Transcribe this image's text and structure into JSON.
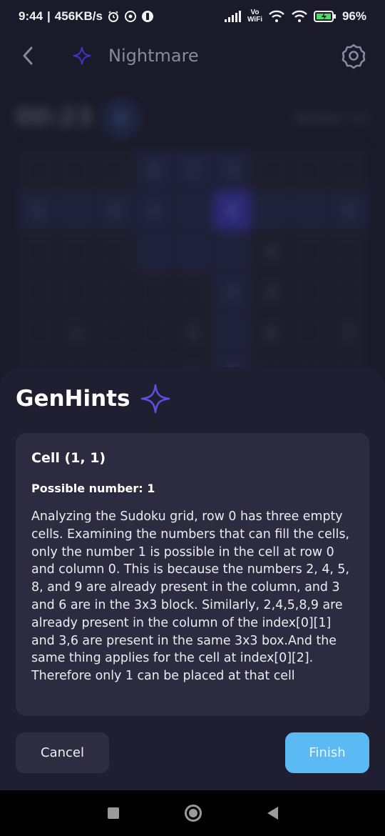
{
  "status_bar": {
    "time": "9:44",
    "net_speed": "456KB/s",
    "volte": "Vo",
    "wifi_label": "WiFi",
    "battery": "96%"
  },
  "header": {
    "title": "Nightmare"
  },
  "game": {
    "timer": "00:23",
    "mistakes": "Mistakes: 1/3",
    "pause_label": "II",
    "cells": [
      "",
      "",
      "",
      "6",
      "7",
      "3",
      "",
      "",
      "",
      "3",
      "",
      "6",
      "2",
      "",
      "1",
      "",
      "",
      "5",
      "",
      "",
      "",
      "",
      "",
      "",
      "4",
      "",
      "",
      "",
      "",
      "",
      "",
      "",
      "4",
      "3",
      "",
      "",
      "",
      "1",
      "",
      "",
      "3",
      "",
      "6",
      "",
      "7",
      "",
      "",
      "",
      "",
      "6",
      "8",
      "",
      "",
      ""
    ]
  },
  "sheet": {
    "title": "GenHints",
    "cell_label": "Cell (1, 1)",
    "possible_number": "Possible number: 1",
    "explanation": "Analyzing the Sudoku grid, row 0 has three empty cells. Examining the numbers that can fill the cells, only the number 1 is possible in the cell at row 0 and column 0. This is because the numbers 2, 4, 5, 8, and 9 are already present in the column, and 3 and 6 are in the 3x3 block. Similarly, 2,4,5,8,9 are already present in the column of the index[0][1] and 3,6 are present in the same 3x3 box.And the same thing applies for the cell at index[0][2]. Therefore only 1 can be placed at that cell",
    "cancel_label": "Cancel",
    "finish_label": "Finish"
  },
  "colors": {
    "accent": "#5b4ee0",
    "finish_button": "#5bb9f4",
    "sheet_bg": "#201f32",
    "card_bg": "#2d2b40"
  },
  "icons": {
    "back": "chevron-left-icon",
    "sparkle": "sparkle-icon",
    "settings": "gear-icon"
  }
}
